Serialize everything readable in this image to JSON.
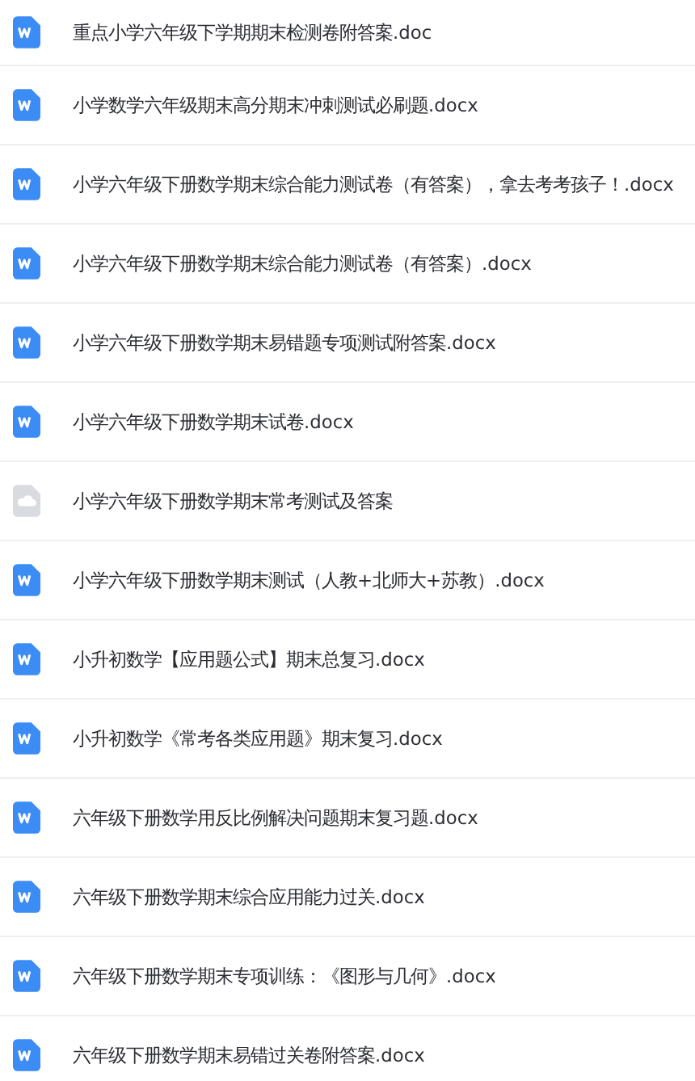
{
  "files": [
    {
      "kind": "word",
      "name": "重点小学六年级下学期期末检测卷附答案.doc"
    },
    {
      "kind": "word",
      "name": "小学数学六年级期末高分期末冲刺测试必刷题.docx"
    },
    {
      "kind": "word",
      "name": "小学六年级下册数学期末综合能力测试卷（有答案），拿去考考孩子！.docx"
    },
    {
      "kind": "word",
      "name": "小学六年级下册数学期末综合能力测试卷（有答案）.docx"
    },
    {
      "kind": "word",
      "name": "小学六年级下册数学期末易错题专项测试附答案.docx"
    },
    {
      "kind": "word",
      "name": "小学六年级下册数学期末试卷.docx"
    },
    {
      "kind": "cloud",
      "name": "小学六年级下册数学期末常考测试及答案"
    },
    {
      "kind": "word",
      "name": "小学六年级下册数学期末测试（人教+北师大+苏教）.docx"
    },
    {
      "kind": "word",
      "name": "小升初数学【应用题公式】期末总复习.docx"
    },
    {
      "kind": "word",
      "name": "小升初数学《常考各类应用题》期末复习.docx"
    },
    {
      "kind": "word",
      "name": "六年级下册数学用反比例解决问题期末复习题.docx"
    },
    {
      "kind": "word",
      "name": "六年级下册数学期末综合应用能力过关.docx"
    },
    {
      "kind": "word",
      "name": "六年级下册数学期末专项训练：《图形与几何》.docx"
    },
    {
      "kind": "word",
      "name": "六年级下册数学期末易错过关卷附答案.docx"
    }
  ]
}
